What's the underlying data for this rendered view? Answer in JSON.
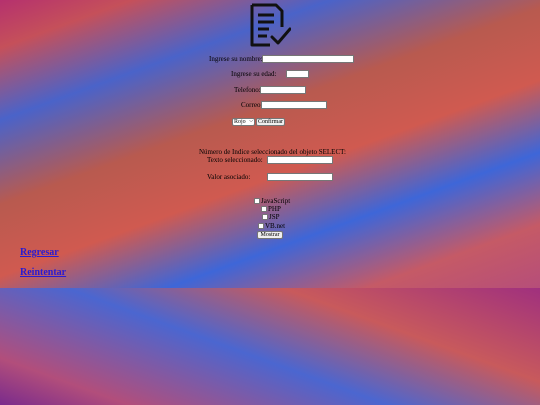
{
  "form": {
    "name_label": "Ingrese su nombre:",
    "age_label": "Ingrese su edad:",
    "phone_label": "Telefono:",
    "email_label": "Correo:",
    "name_value": "",
    "age_value": "",
    "phone_value": "",
    "email_value": ""
  },
  "select": {
    "selected": "Rojo",
    "confirm_label": "Confirmar"
  },
  "result": {
    "index_label": "Número de Indice seleccionado del objeto SELECT:",
    "text_label": "Texto seleccionado:",
    "value_label": "Valor asociado:",
    "text_value": "",
    "value_value": ""
  },
  "languages": [
    {
      "label": "JavaScript",
      "checked": false
    },
    {
      "label": "PHP",
      "checked": false
    },
    {
      "label": "JSP",
      "checked": false
    },
    {
      "label": "VB.net",
      "checked": false
    }
  ],
  "show_label": "Mostrar",
  "links": {
    "back": "Regresar",
    "retry": "Reintentar"
  },
  "icon": "document-checklist-icon"
}
